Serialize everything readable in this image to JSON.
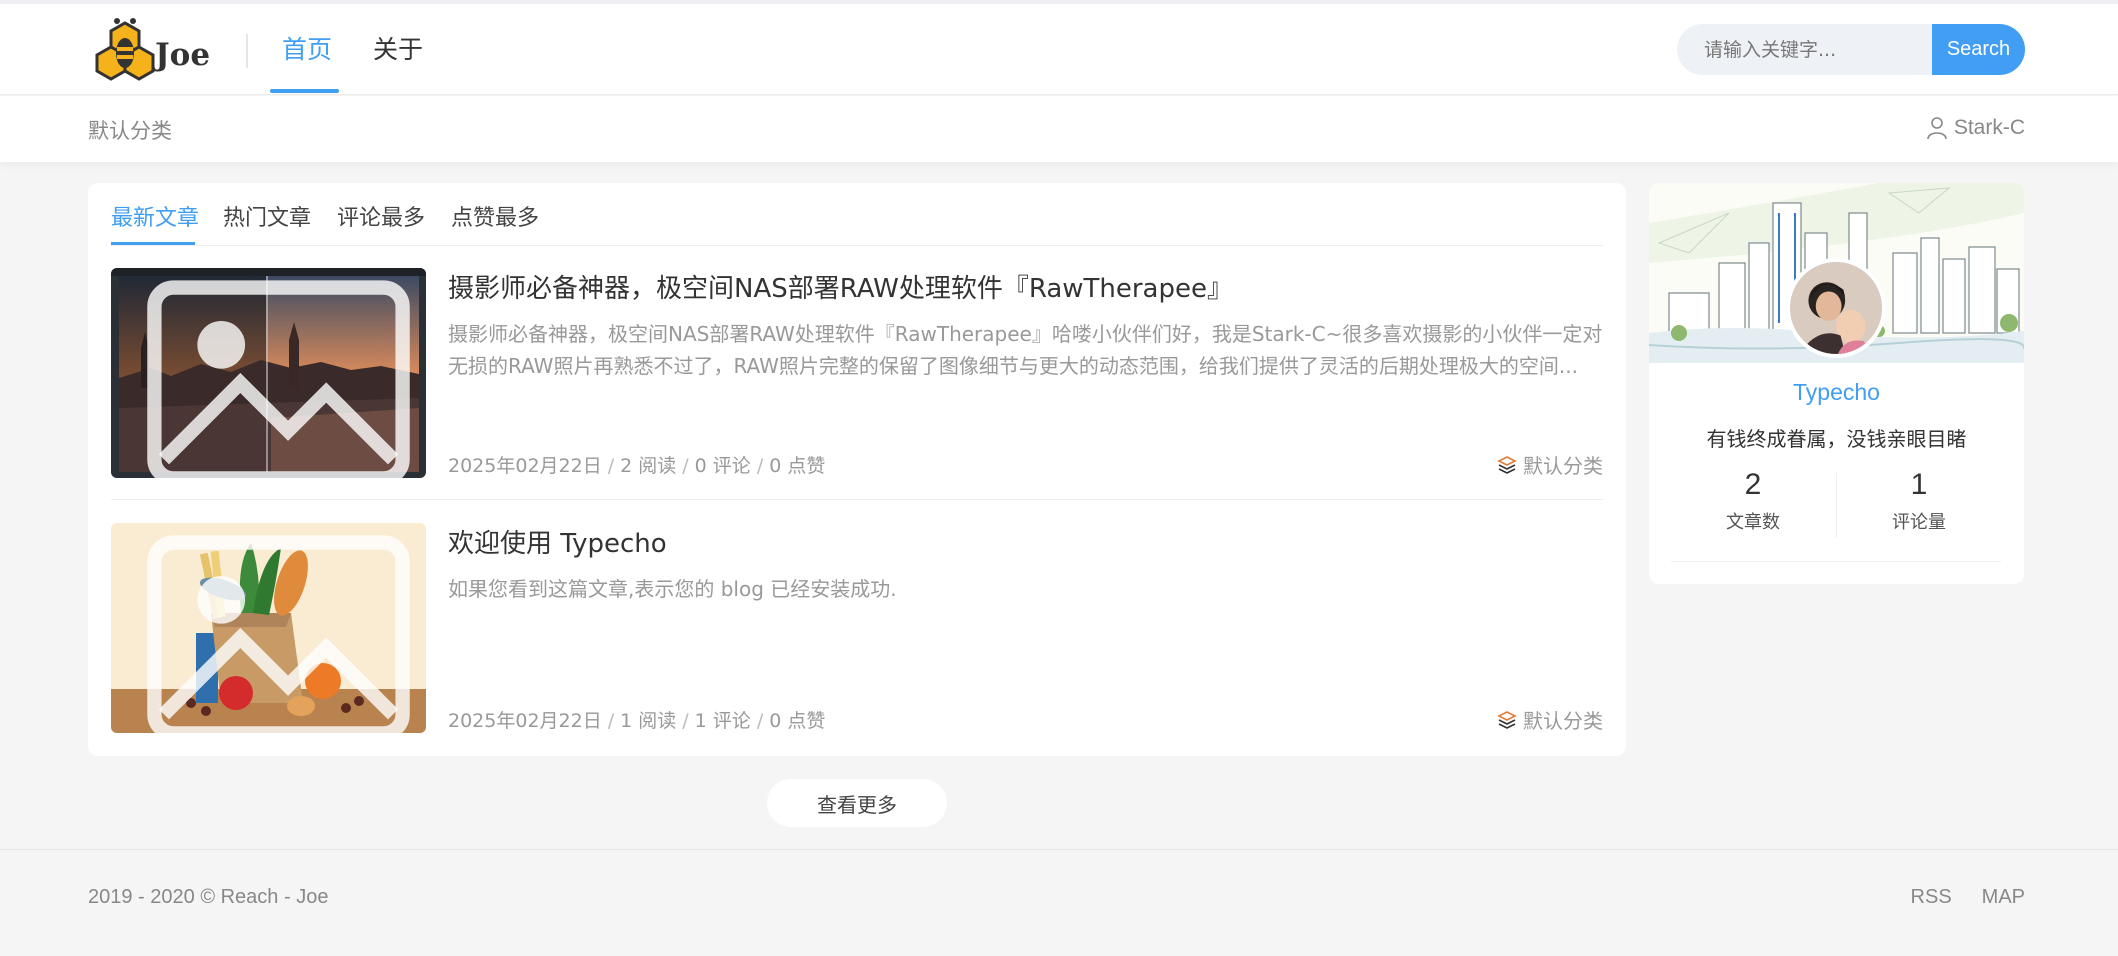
{
  "header": {
    "logo_text": "Joe",
    "nav": [
      {
        "label": "首页",
        "active": true
      },
      {
        "label": "关于",
        "active": false
      }
    ],
    "search": {
      "placeholder": "请输入关键字...",
      "button_label": "Search"
    }
  },
  "subbar": {
    "breadcrumb": "默认分类",
    "user": "Stark-C"
  },
  "tabs": [
    {
      "label": "最新文章",
      "active": true
    },
    {
      "label": "热门文章",
      "active": false
    },
    {
      "label": "评论最多",
      "active": false
    },
    {
      "label": "点赞最多",
      "active": false
    }
  ],
  "posts": [
    {
      "title": "摄影师必备神器，极空间NAS部署RAW处理软件『RawTherapee』",
      "excerpt": "摄影师必备神器，极空间NAS部署RAW处理软件『RawTherapee』哈喽小伙伴们好，我是Stark-C~很多喜欢摄影的小伙伴一定对无损的RAW照片再熟悉不过了，RAW照片完整的保留了图像细节与更大的动态范围，给我们提供了灵活的后期处理极大的空间...",
      "date": "2025年02月22日",
      "reads": "2 阅读",
      "comments": "0 评论",
      "likes": "0 点赞",
      "category": "默认分类"
    },
    {
      "title": "欢迎使用 Typecho",
      "excerpt": "如果您看到这篇文章,表示您的 blog 已经安装成功.",
      "date": "2025年02月22日",
      "reads": "1 阅读",
      "comments": "1 评论",
      "likes": "0 点赞",
      "category": "默认分类"
    }
  ],
  "more_button": "查看更多",
  "sidebar": {
    "name": "Typecho",
    "motto": "有钱终成眷属，没钱亲眼目睹",
    "stats": [
      {
        "value": "2",
        "label": "文章数"
      },
      {
        "value": "1",
        "label": "评论量"
      }
    ]
  },
  "footer": {
    "copyright": "2019 - 2020 © Reach - Joe",
    "links": [
      "RSS",
      "MAP"
    ]
  },
  "colors": {
    "accent": "#419ef3",
    "background": "#f5f5f5",
    "muted_text": "#999999"
  }
}
